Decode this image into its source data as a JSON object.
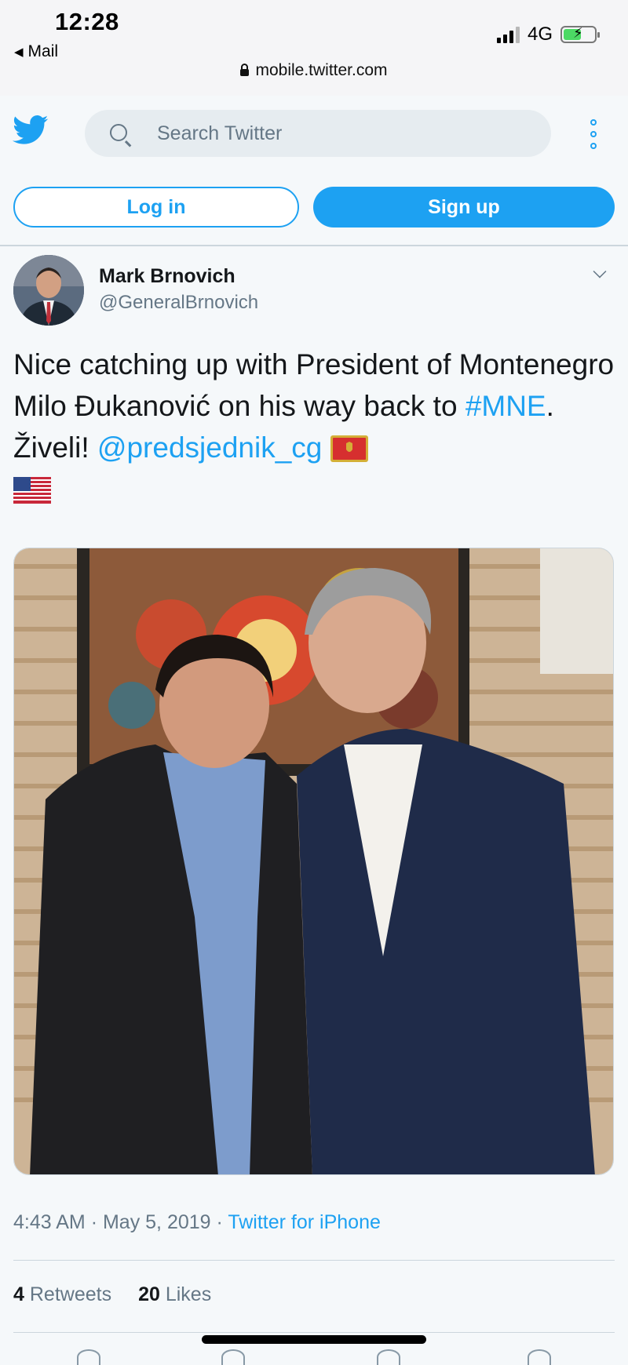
{
  "status_bar": {
    "time": "12:28",
    "back_app": "Mail",
    "network": "4G",
    "url": "mobile.twitter.com"
  },
  "header": {
    "search_placeholder": "Search Twitter",
    "login_label": "Log in",
    "signup_label": "Sign up",
    "brand_color": "#1da1f2"
  },
  "tweet": {
    "author": "Mark Brnovich",
    "handle": "@GeneralBrnovich",
    "text_part1": "Nice catching up with President of Montenegro Milo Đukanović on his way back to ",
    "hashtag": "#MNE",
    "text_part2": ". Živeli!  ",
    "mention": "@predsjednik_cg",
    "flags": [
      "montenegro-flag",
      "usa-flag"
    ],
    "time": "4:43 AM",
    "date": "May 5, 2019",
    "separator": "·",
    "source": "Twitter for iPhone",
    "retweets_count": "4",
    "retweets_label": "Retweets",
    "likes_count": "20",
    "likes_label": "Likes"
  }
}
